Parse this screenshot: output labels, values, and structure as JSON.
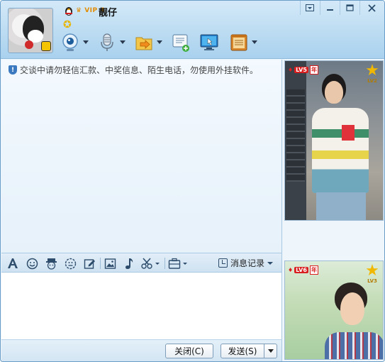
{
  "contact": {
    "name": "靓仔",
    "vip_label": "VIP 4"
  },
  "window_controls": {
    "menu": "menu",
    "minimize": "minimize",
    "maximize": "maximize",
    "close": "close"
  },
  "toolbar_top": {
    "items": [
      "video-call-icon",
      "voice-call-icon",
      "file-transfer-icon",
      "create-discussion-icon",
      "remote-assistance-icon",
      "app-box-icon"
    ]
  },
  "chat": {
    "security_notice": "交谈中请勿轻信汇款、中奖信息、陌生电话，勿使用外挂软件。"
  },
  "input_toolbar": {
    "icons": [
      "font-icon",
      "emoji-icon",
      "magic-face-icon",
      "shake-icon",
      "doodle-icon",
      "image-icon",
      "music-icon",
      "screenshot-icon",
      "more-apps-icon"
    ],
    "message_record": "消息记录"
  },
  "buttons": {
    "close": "关闭(C)",
    "send": "发送(S)"
  },
  "right_panel": {
    "show1": {
      "level": "LV5",
      "year_badge": "年",
      "star_level": "LV2"
    },
    "show2": {
      "level": "LV6",
      "year_badge": "年",
      "star_level": "LV3"
    }
  },
  "colors": {
    "header_top": "#d4e9f8",
    "header_bottom": "#a9d1ee",
    "border": "#6a9ec9",
    "vip": "#e38b00",
    "level_badge": "#d81e1e"
  }
}
